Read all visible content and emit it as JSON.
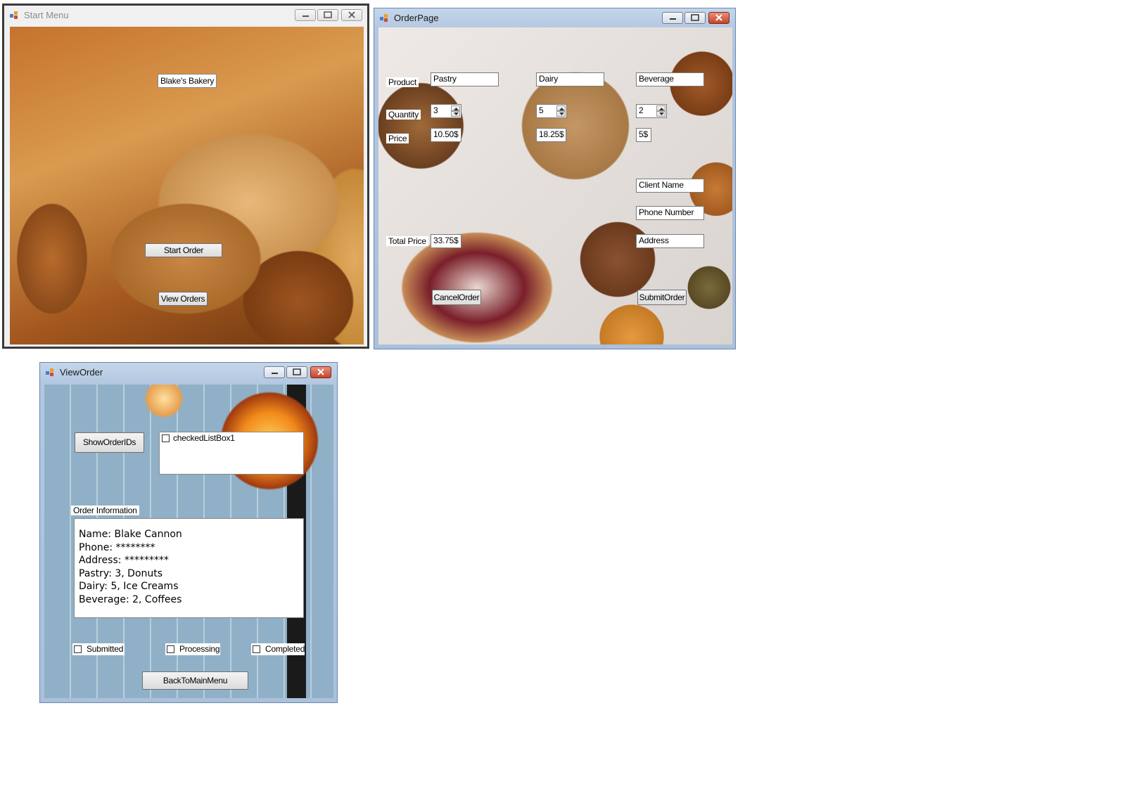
{
  "colors": {
    "inactive_title": "#8c8c8c",
    "aero_frame": "#aac1dc",
    "close_red": "#c4442c"
  },
  "start_menu": {
    "title": "Start Menu",
    "bakery_label": "Blake's Bakery",
    "start_order_button": "Start Order",
    "view_orders_button": "View Orders"
  },
  "order_page": {
    "title": "OrderPage",
    "product_label": "Product",
    "quantity_label": "Quantity",
    "price_label": "Price",
    "total_price_label": "Total Price",
    "products": [
      {
        "name": "Pastry",
        "quantity": "3",
        "price": "10.50$"
      },
      {
        "name": "Dairy",
        "quantity": "5",
        "price": "18.25$"
      },
      {
        "name": "Beverage",
        "quantity": "2",
        "price": "5$"
      }
    ],
    "total_price": "33.75$",
    "client_name": "Client Name",
    "phone_number": "Phone Number",
    "address": "Address",
    "cancel_button": "CancelOrder",
    "submit_button": "SubmitOrder"
  },
  "view_order": {
    "title": "ViewOrder",
    "show_ids_button": "ShowOrderIDs",
    "checked_list_item": "checkedListBox1",
    "order_info_label": "Order Information",
    "order_lines": [
      "Name: Blake Cannon",
      "Phone: ********",
      "Address: *********",
      "Pastry: 3, Donuts",
      "Dairy: 5, Ice Creams",
      "Beverage: 2, Coffees"
    ],
    "status_submitted": "Submitted",
    "status_processing": "Processing",
    "status_completed": "Completed",
    "back_button": "BackToMainMenu"
  }
}
